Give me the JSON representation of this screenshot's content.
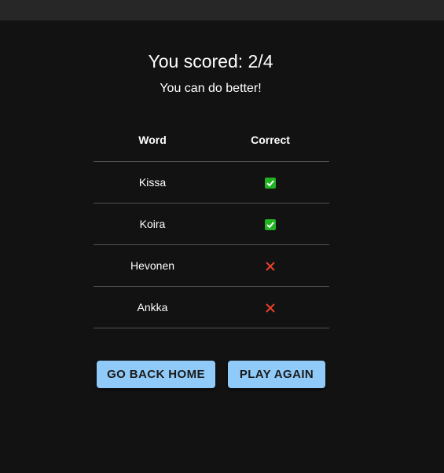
{
  "score": {
    "title": "You scored: 2/4",
    "message": "You can do better!"
  },
  "table": {
    "headers": [
      "Word",
      "Correct"
    ],
    "rows": [
      {
        "word": "Kissa",
        "correct": true,
        "icon": "check-icon"
      },
      {
        "word": "Koira",
        "correct": true,
        "icon": "check-icon"
      },
      {
        "word": "Hevonen",
        "correct": false,
        "icon": "cross-icon"
      },
      {
        "word": "Ankka",
        "correct": false,
        "icon": "cross-icon"
      }
    ]
  },
  "actions": {
    "home_label": "GO BACK HOME",
    "again_label": "PLAY AGAIN"
  },
  "colors": {
    "background": "#121212",
    "topbar": "#272727",
    "button": "#90caf9",
    "check": "#21b321",
    "cross": "#e8412c"
  }
}
